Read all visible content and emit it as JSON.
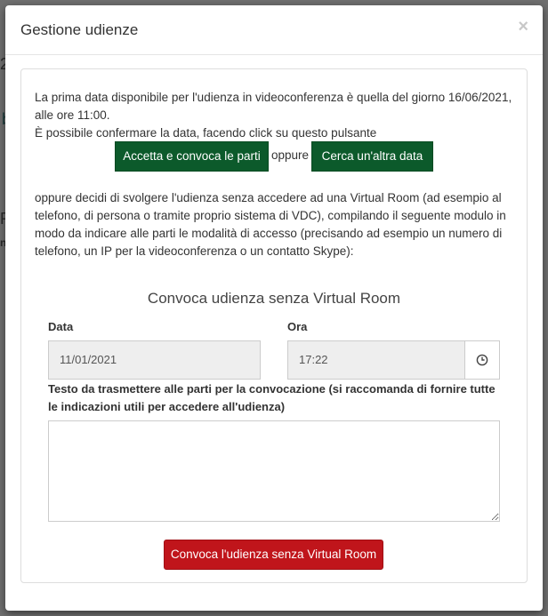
{
  "background": {
    "fragments": [
      "2",
      "b",
      "R",
      "na"
    ]
  },
  "modal": {
    "title": "Gestione udienze",
    "close_symbol": "×",
    "intro_line1": "La prima data disponibile per l'udienza in videoconferenza è quella del giorno 16/06/2021,",
    "intro_line2": "alle ore 11:00.",
    "intro_line3": "È possibile confermare la data, facendo click su questo pulsante",
    "accept_button": "Accetta e convoca le parti",
    "or_text": "oppure",
    "search_button": "Cerca un'altra data",
    "alt_line1": "oppure decidi di svolgere l'udienza senza accedere ad una Virtual Room (ad esempio al",
    "alt_line2": "telefono, di persona o tramite proprio sistema di VDC), compilando il seguente modulo in",
    "alt_line3": "modo da indicare alle parti le modalità di accesso (precisando ad esempio un numero di",
    "alt_line4": "telefono, un IP per la videoconferenza o un contatto Skype):",
    "form_title": "Convoca udienza senza Virtual Room",
    "date_label": "Data",
    "date_value": "11/01/2021",
    "time_label": "Ora",
    "time_value": "17:22",
    "message_label_line1": "Testo da trasmettere alle parti per la convocazione (si raccomanda di fornire tutte",
    "message_label_line2": "le indicazioni utili per accedere all'udienza)",
    "message_value": "",
    "submit_button": "Convoca l'udienza senza Virtual Room",
    "colors": {
      "green": "#0c5a2b",
      "red": "#c0151b",
      "overlay": "#6f6f6f"
    },
    "icons": [
      "close-icon",
      "clock-icon"
    ]
  }
}
